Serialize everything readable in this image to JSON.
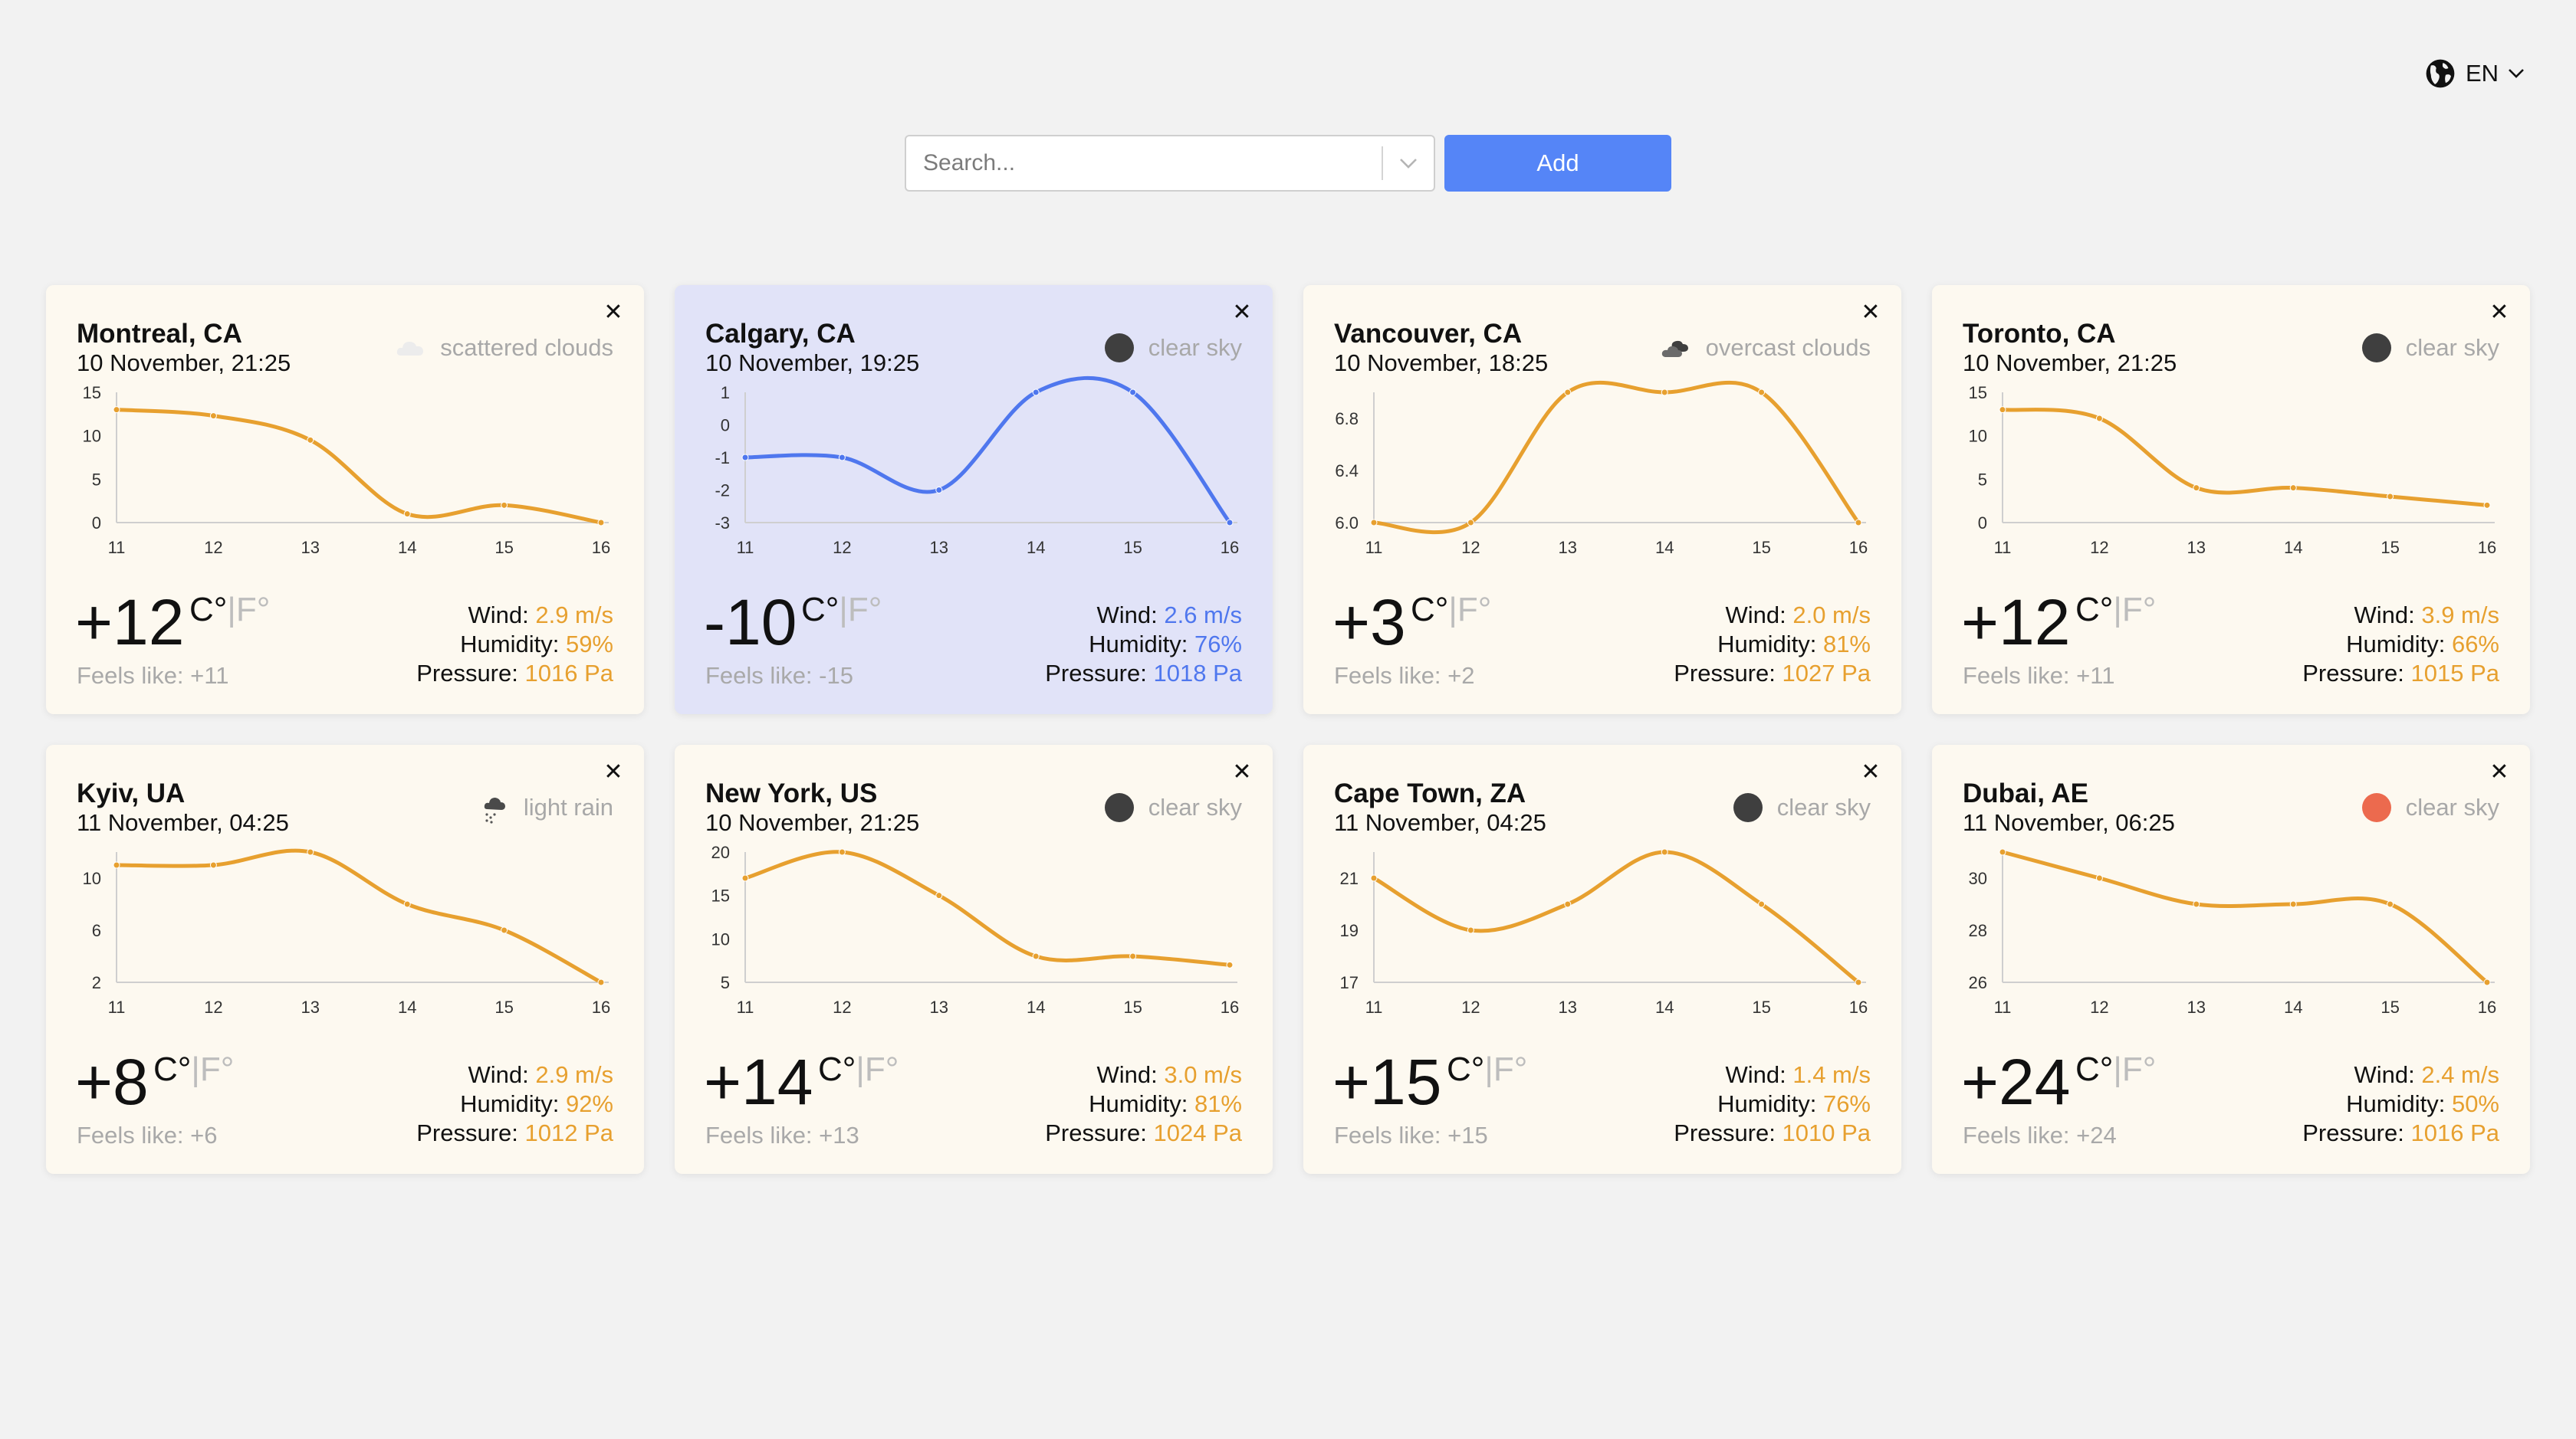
{
  "lang": {
    "code": "EN"
  },
  "search": {
    "placeholder": "Search...",
    "add_label": "Add"
  },
  "labels": {
    "wind": "Wind:",
    "humidity": "Humidity:",
    "pressure": "Pressure:",
    "feels": "Feels like:",
    "unit_c": "C°",
    "unit_sep": "|",
    "unit_f": "F°"
  },
  "colors": {
    "accent": "#5585f7",
    "line_default": "#e7a02f",
    "line_active": "#4f77ee",
    "card_bg": "#fdf9f0",
    "card_active_bg": "#e1e3f8"
  },
  "cards": [
    {
      "city": "Montreal, CA",
      "date": "10 November, 21:25",
      "condition": "scattered clouds",
      "icon": "cloud-icon",
      "temp": "+12",
      "feels": "+11",
      "wind": "2.9 m/s",
      "humidity": "59%",
      "pressure": "1016 Pa",
      "active": false
    },
    {
      "city": "Calgary, CA",
      "date": "10 November, 19:25",
      "condition": "clear sky",
      "icon": "clear-sky-icon",
      "temp": "-10",
      "feels": "-15",
      "wind": "2.6 m/s",
      "humidity": "76%",
      "pressure": "1018 Pa",
      "active": true
    },
    {
      "city": "Vancouver, CA",
      "date": "10 November, 18:25",
      "condition": "overcast clouds",
      "icon": "overcast-clouds-icon",
      "temp": "+3",
      "feels": "+2",
      "wind": "2.0 m/s",
      "humidity": "81%",
      "pressure": "1027 Pa",
      "active": false
    },
    {
      "city": "Toronto, CA",
      "date": "10 November, 21:25",
      "condition": "clear sky",
      "icon": "clear-sky-icon",
      "temp": "+12",
      "feels": "+11",
      "wind": "3.9 m/s",
      "humidity": "66%",
      "pressure": "1015 Pa",
      "active": false
    },
    {
      "city": "Kyiv, UA",
      "date": "11 November, 04:25",
      "condition": "light rain",
      "icon": "light-rain-icon",
      "temp": "+8",
      "feels": "+6",
      "wind": "2.9 m/s",
      "humidity": "92%",
      "pressure": "1012 Pa",
      "active": false
    },
    {
      "city": "New York, US",
      "date": "10 November, 21:25",
      "condition": "clear sky",
      "icon": "clear-sky-icon",
      "temp": "+14",
      "feels": "+13",
      "wind": "3.0 m/s",
      "humidity": "81%",
      "pressure": "1024 Pa",
      "active": false
    },
    {
      "city": "Cape Town, ZA",
      "date": "11 November, 04:25",
      "condition": "clear sky",
      "icon": "clear-sky-icon",
      "temp": "+15",
      "feels": "+15",
      "wind": "1.4 m/s",
      "humidity": "76%",
      "pressure": "1010 Pa",
      "active": false
    },
    {
      "city": "Dubai, AE",
      "date": "11 November, 06:25",
      "condition": "clear sky",
      "icon": "sun-icon",
      "temp": "+24",
      "feels": "+24",
      "wind": "2.4 m/s",
      "humidity": "50%",
      "pressure": "1016 Pa",
      "active": false
    }
  ],
  "chart_data": [
    {
      "type": "line",
      "x": [
        11,
        12,
        13,
        14,
        15,
        16
      ],
      "values": [
        13,
        12.3,
        9.5,
        1,
        2,
        0
      ],
      "ylim": [
        0,
        15
      ],
      "yticks": [
        "0",
        "5",
        "10",
        "15"
      ]
    },
    {
      "type": "line",
      "x": [
        11,
        12,
        13,
        14,
        15,
        16
      ],
      "values": [
        -1,
        -1,
        -2,
        1,
        1,
        -3
      ],
      "ylim": [
        -3,
        1
      ],
      "yticks": [
        "-3",
        "-2",
        "-1",
        "0",
        "1"
      ]
    },
    {
      "type": "line",
      "x": [
        11,
        12,
        13,
        14,
        15,
        16
      ],
      "values": [
        6.0,
        6.0,
        7.0,
        7.0,
        7.0,
        6.0
      ],
      "ylim": [
        6.0,
        7.0
      ],
      "yticks": [
        "6.0",
        "6.4",
        "6.8"
      ]
    },
    {
      "type": "line",
      "x": [
        11,
        12,
        13,
        14,
        15,
        16
      ],
      "values": [
        13,
        12,
        4,
        4,
        3,
        2
      ],
      "ylim": [
        0,
        15
      ],
      "yticks": [
        "0",
        "5",
        "10",
        "15"
      ]
    },
    {
      "type": "line",
      "x": [
        11,
        12,
        13,
        14,
        15,
        16
      ],
      "values": [
        11,
        11,
        12,
        8,
        6,
        2
      ],
      "ylim": [
        2,
        12
      ],
      "yticks": [
        "2",
        "6",
        "10"
      ]
    },
    {
      "type": "line",
      "x": [
        11,
        12,
        13,
        14,
        15,
        16
      ],
      "values": [
        17,
        20,
        15,
        8,
        8,
        7
      ],
      "ylim": [
        5,
        20
      ],
      "yticks": [
        "5",
        "10",
        "15",
        "20"
      ]
    },
    {
      "type": "line",
      "x": [
        11,
        12,
        13,
        14,
        15,
        16
      ],
      "values": [
        21,
        19,
        20,
        22,
        20,
        17
      ],
      "ylim": [
        17,
        22
      ],
      "yticks": [
        "17",
        "19",
        "21"
      ]
    },
    {
      "type": "line",
      "x": [
        11,
        12,
        13,
        14,
        15,
        16
      ],
      "values": [
        31,
        30,
        29,
        29,
        29,
        26
      ],
      "ylim": [
        26,
        31
      ],
      "yticks": [
        "26",
        "28",
        "30"
      ]
    }
  ]
}
